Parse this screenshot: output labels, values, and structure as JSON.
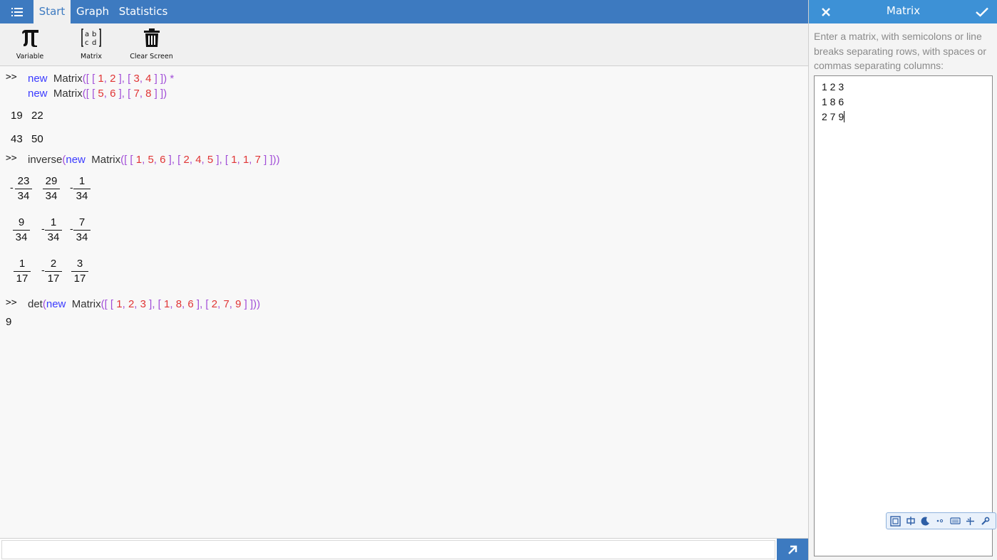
{
  "tabs": [
    "Start",
    "Graph",
    "Statistics"
  ],
  "ribbon": {
    "variable_label": "Variable",
    "matrix_label": "Matrix",
    "clear_label": "Clear Screen"
  },
  "console": {
    "prompt": ">>",
    "entry1": {
      "line1": {
        "kw": "new",
        "fn": "Matrix",
        "open": "([",
        "b1": "[",
        "a": "1",
        "b": "2",
        "c1": "],",
        "b2": "[",
        "c": "3",
        "d": "4",
        "c2": "]",
        "close": "])",
        "op": "*"
      },
      "line2": {
        "kw": "new",
        "fn": "Matrix",
        "open": "([",
        "b1": "[",
        "a": "5",
        "b": "6",
        "c1": "],",
        "b2": "[",
        "c": "7",
        "d": "8",
        "c2": "]",
        "close": "])"
      },
      "result": [
        [
          "19",
          "22"
        ],
        [
          "43",
          "50"
        ]
      ]
    },
    "entry2": {
      "fn": "inverse",
      "open_paren": "(",
      "kw": "new",
      "fn2": "Matrix",
      "open": "([",
      "rows": [
        [
          "1",
          "5",
          "6"
        ],
        [
          "2",
          "4",
          "5"
        ],
        [
          "1",
          "1",
          "7"
        ]
      ],
      "close": "]))",
      "result": [
        [
          {
            "sign": "-",
            "n": "23",
            "d": "34"
          },
          {
            "sign": "",
            "n": "29",
            "d": "34"
          },
          {
            "sign": "-",
            "n": "1",
            "d": "34"
          }
        ],
        [
          {
            "sign": "",
            "n": "9",
            "d": "34"
          },
          {
            "sign": "-",
            "n": "1",
            "d": "34"
          },
          {
            "sign": "-",
            "n": "7",
            "d": "34"
          }
        ],
        [
          {
            "sign": "",
            "n": "1",
            "d": "17"
          },
          {
            "sign": "-",
            "n": "2",
            "d": "17"
          },
          {
            "sign": "",
            "n": "3",
            "d": "17"
          }
        ]
      ]
    },
    "entry3": {
      "fn": "det",
      "open_paren": "(",
      "kw": "new",
      "fn2": "Matrix",
      "open": "([",
      "rows": [
        [
          "1",
          "2",
          "3"
        ],
        [
          "1",
          "8",
          "6"
        ],
        [
          "2",
          "7",
          "9"
        ]
      ],
      "close": "]))",
      "result": "9"
    }
  },
  "input": {
    "value": "",
    "placeholder": ""
  },
  "panel": {
    "title": "Matrix",
    "description": "Enter a matrix, with semicolons or line breaks separating rows, with spaces or commas separating columns:",
    "matrix_lines": [
      "1 2 3",
      "1 8 6",
      "2 7 9"
    ]
  },
  "icons": {
    "menu": "menu-icon",
    "pi": "pi-icon",
    "matrix": "matrix-icon",
    "trash": "trash-icon",
    "submit": "arrow-up-right-icon",
    "close": "close-icon",
    "ok": "checkmark-icon"
  },
  "colors": {
    "topbar": "#3d7ac0",
    "panel_header": "#3d91d6",
    "keyword": "#3b3bff",
    "bracket": "#a24fd8",
    "number": "#e03535"
  }
}
